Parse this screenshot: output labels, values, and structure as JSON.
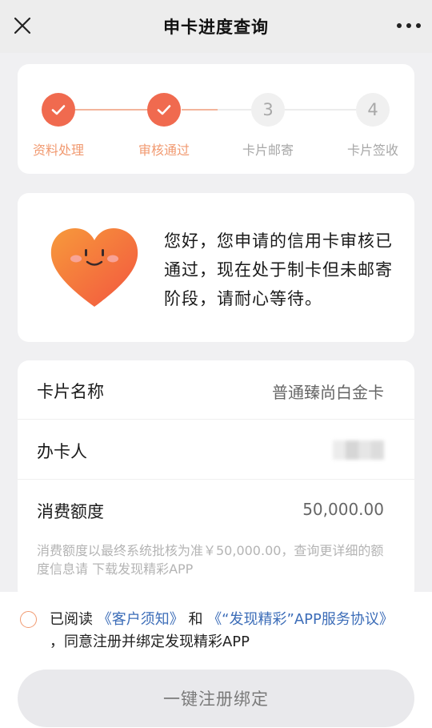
{
  "navbar": {
    "title": "申卡进度查询"
  },
  "steps": [
    {
      "label": "资料处理",
      "number": "1",
      "status": "done"
    },
    {
      "label": "审核通过",
      "number": "2",
      "status": "done"
    },
    {
      "label": "卡片邮寄",
      "number": "3",
      "status": "todo"
    },
    {
      "label": "卡片签收",
      "number": "4",
      "status": "todo"
    }
  ],
  "message": {
    "text": "您好，您申请的信用卡审核已通过，现在处于制卡但未邮寄阶段，请耐心等待。"
  },
  "info": {
    "rows": [
      {
        "label": "卡片名称",
        "value": "普通臻尚白金卡"
      },
      {
        "label": "办卡人",
        "value": ""
      },
      {
        "label": "消费额度",
        "value": "50,000.00"
      }
    ],
    "note": "消费额度以最终系统批核为准￥50,000.00，查询更详细的额度信息请 下载发现精彩APP"
  },
  "agreement": {
    "prefix": "已阅读 ",
    "link1": "《客户须知》",
    "middle": " 和 ",
    "link2": "《“发现精彩”APP服务协议》",
    "suffix": " ，同意注册并绑定发现精彩APP"
  },
  "submit_label": "一键注册绑定",
  "colors": {
    "accent": "#f06a4f",
    "accent_text": "#f19a71",
    "link": "#3c6db8"
  }
}
